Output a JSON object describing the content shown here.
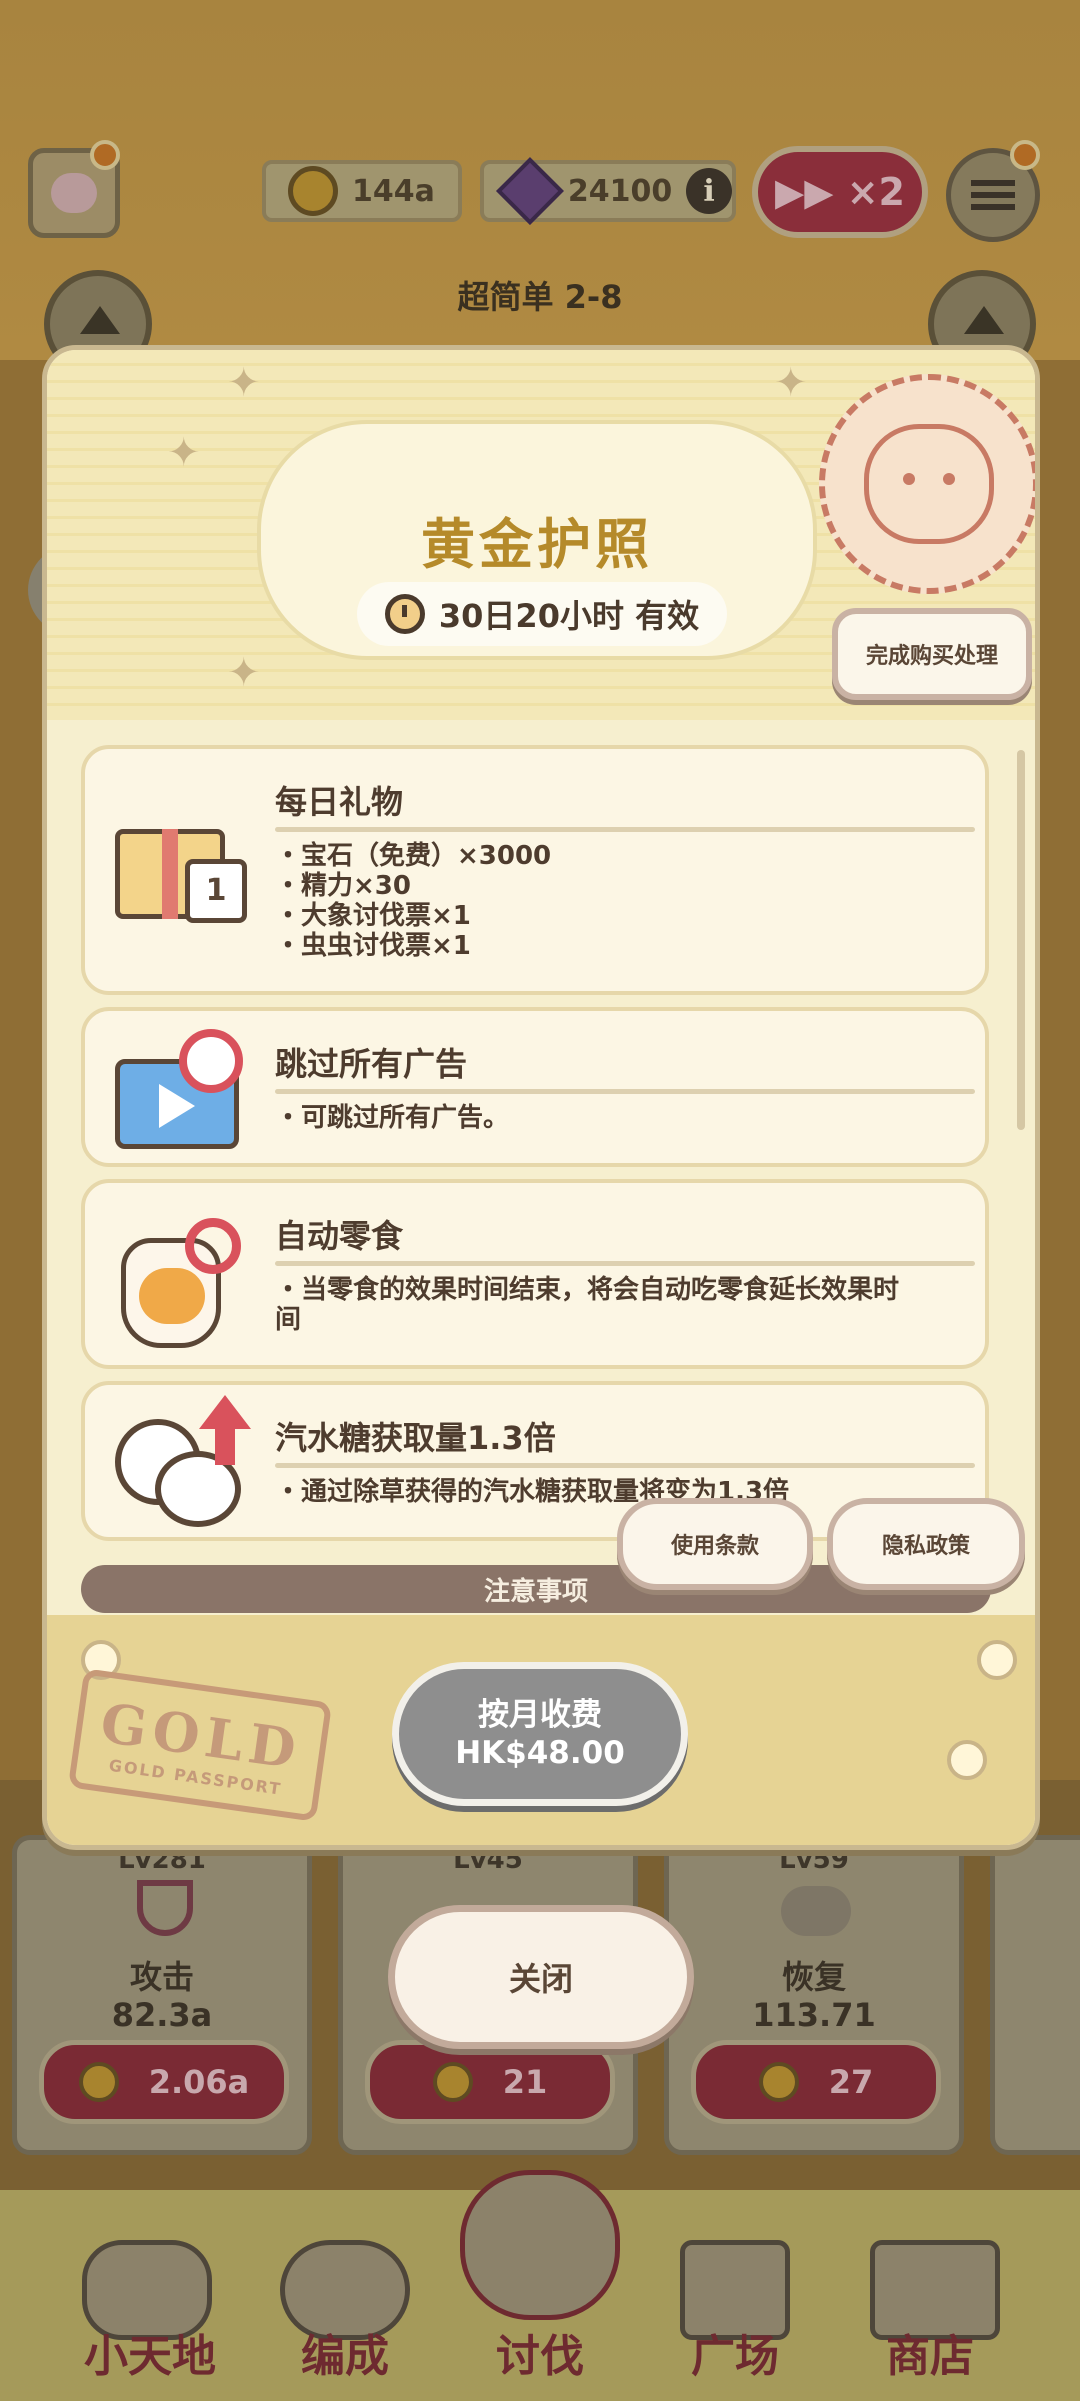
{
  "hud": {
    "coins": "144a",
    "gems": "24100",
    "info_glyph": "i",
    "speed_label": "▶▶ ×2",
    "stage_title": "超简单 2-8"
  },
  "modal": {
    "title": "黄金护照",
    "validity": "30日20小时 有效",
    "purchase_button": "完成购买处理",
    "features": [
      {
        "title": "每日礼物",
        "lines": [
          "・宝石（免费）×3000",
          "・精力×30",
          "・大象讨伐票×1",
          "・虫虫讨伐票×1"
        ]
      },
      {
        "title": "跳过所有广告",
        "lines": [
          "・可跳过所有广告。"
        ]
      },
      {
        "title": "自动零食",
        "lines": [
          "・当零食的效果时间结束，将会自动吃零食延长效果时",
          "间"
        ]
      },
      {
        "title": "汽水糖获取量1.3倍",
        "lines": [
          "・通过除草获得的汽水糖获取量将变为1.3倍"
        ]
      }
    ],
    "calendar_day": "1",
    "terms_button": "使用条款",
    "privacy_button": "隐私政策",
    "notice_label": "注意事项",
    "stamp_big": "GOLD",
    "stamp_small": "GOLD PASSPORT",
    "price_line1": "按月收费",
    "price_line2": "HK$48.00"
  },
  "close_button": "关闭",
  "stats": [
    {
      "level": "Lv281",
      "name": "攻击",
      "value": "82.3a",
      "cost": "2.06a"
    },
    {
      "level": "Lv45",
      "name": "",
      "value": "",
      "cost": "21"
    },
    {
      "level": "Lv59",
      "name": "恢复",
      "value": "113.71",
      "cost": "27"
    }
  ],
  "nav": [
    "小天地",
    "编成",
    "讨伐",
    "广场",
    "商店"
  ],
  "colors": {
    "accent_gold": "#b58a2a",
    "modal_bg": "#f6efcf",
    "price_button": "#8e8e8e",
    "notice_bar": "#8a7468"
  }
}
